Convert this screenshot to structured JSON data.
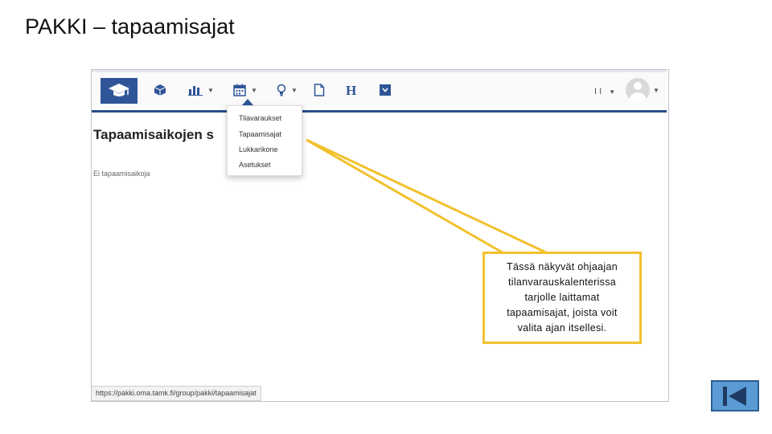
{
  "slide": {
    "title": "PAKKI – tapaamisajat"
  },
  "app": {
    "toolbar": {
      "icons": [
        "graduation-cap-icon",
        "cube-icon",
        "bar-chart-icon",
        "calendar-icon",
        "lightbulb-icon",
        "document-icon",
        "h-icon",
        "dropdown-box-icon"
      ]
    },
    "user_initials": "I I",
    "page_heading": "Tapaamisaikojen s",
    "empty_message": "Ei tapaamisaikoja",
    "calendar_menu": {
      "items": [
        "Tilavaraukset",
        "Tapaamisajat",
        "Lukkarikone",
        "Asetukset"
      ]
    },
    "status_url": "https://pakki.oma.tamk.fi/group/pakki/tapaamisajat"
  },
  "callout": {
    "text": "Tässä näkyvät ohjaajan tilanvarauskalenterissa tarjolle laittamat tapaamisajat, joista voit valita ajan itsellesi."
  },
  "navigation": {
    "first_slide_icon": "skip-to-start-icon"
  },
  "colors": {
    "brand_blue": "#2e5597",
    "callout_border": "#f2c12e",
    "nav_button": "#5b9bd5"
  }
}
